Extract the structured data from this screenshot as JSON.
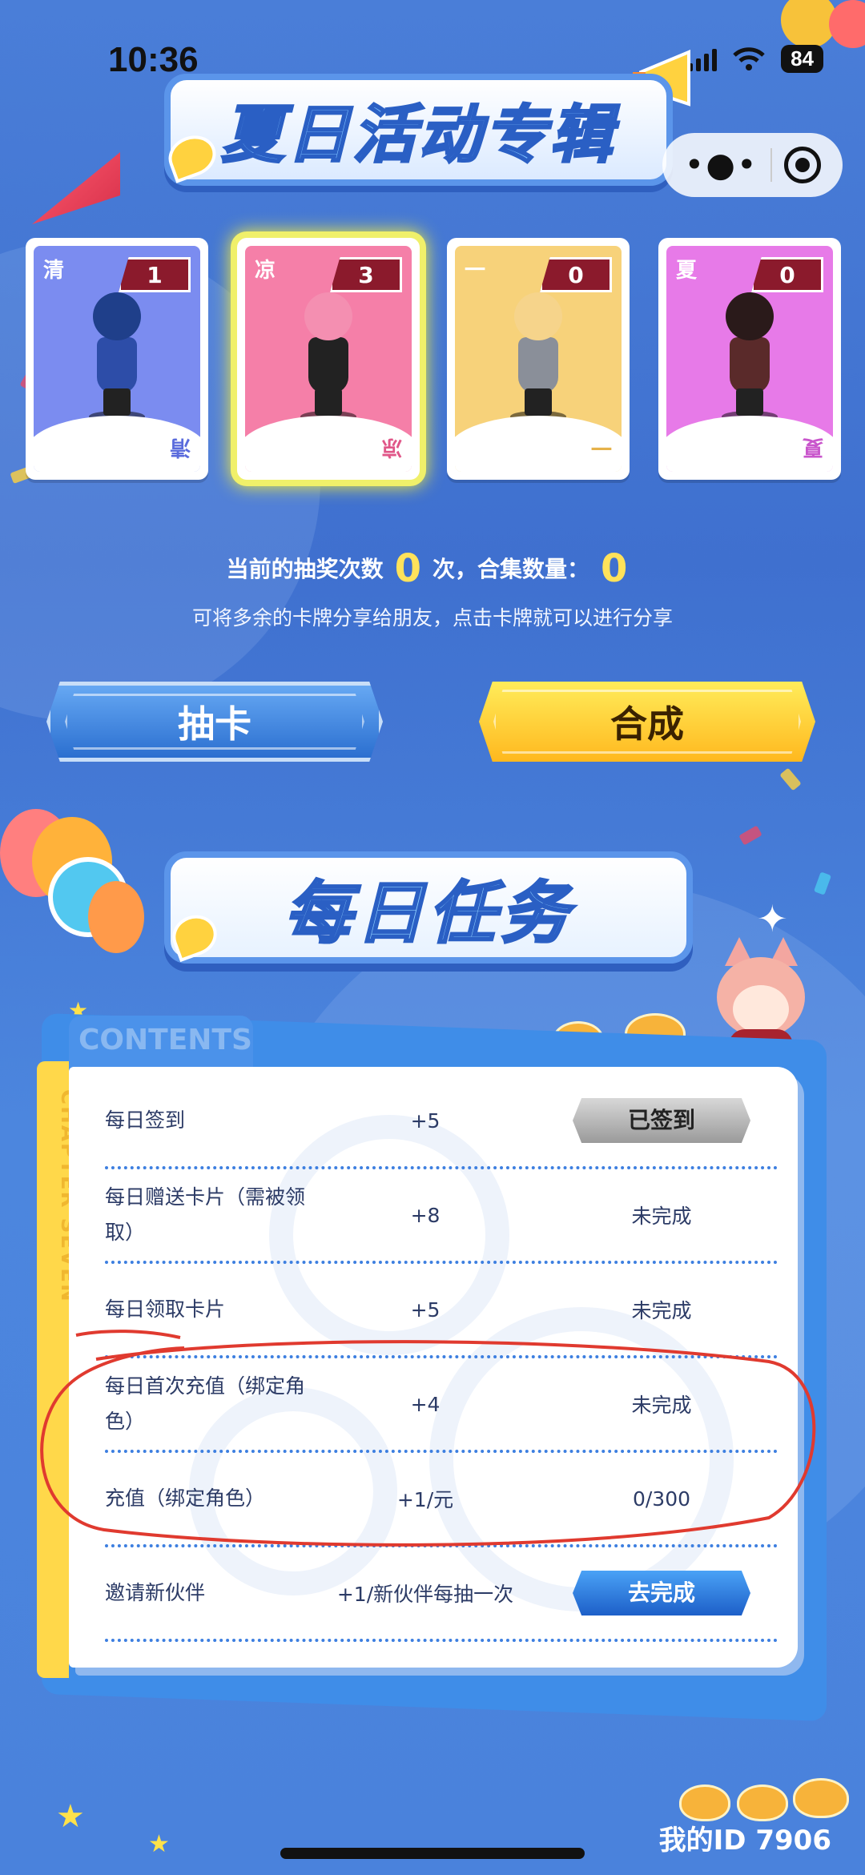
{
  "status_bar": {
    "time": "10:36",
    "battery": "84"
  },
  "header": {
    "title": "夏日活动专辑"
  },
  "cards": [
    {
      "char": "清",
      "count": "1",
      "bg": "#7b8cf0",
      "accent": "#5a6bdc",
      "hair": "#1f3f8a",
      "body": "#2d4da8"
    },
    {
      "char": "凉",
      "count": "3",
      "bg": "#f57fa8",
      "accent": "#e05688",
      "hair": "#f48fb1",
      "body": "#222222"
    },
    {
      "char": "一",
      "count": "0",
      "bg": "#f7d27a",
      "accent": "#e6b24a",
      "hair": "#f6d48b",
      "body": "#8a8f99"
    },
    {
      "char": "夏",
      "count": "0",
      "bg": "#e77ae8",
      "accent": "#c956cc",
      "hair": "#2a1a1a",
      "body": "#5a2a2a"
    }
  ],
  "info": {
    "draw_count_label": "当前的抽奖次数",
    "draw_count": "0",
    "draw_count_unit": "次，合集数量：",
    "collection_count": "0",
    "hint": "可将多余的卡牌分享给朋友，点击卡牌就可以进行分享"
  },
  "actions": {
    "draw_label": "抽卡",
    "merge_label": "合成"
  },
  "daily": {
    "title": "每日任务",
    "contents_tab": "CONTENTS",
    "chapter_label": "CHAPTER SEVEN"
  },
  "tasks": [
    {
      "name": "每日签到",
      "reward": "+5",
      "status": "已签到",
      "status_type": "done"
    },
    {
      "name": "每日赠送卡片（需被领取）",
      "reward": "+8",
      "status": "未完成",
      "status_type": "text"
    },
    {
      "name": "每日领取卡片",
      "reward": "+5",
      "status": "未完成",
      "status_type": "text"
    },
    {
      "name": "每日首次充值（绑定角色）",
      "reward": "+4",
      "status": "未完成",
      "status_type": "text"
    },
    {
      "name": "充值（绑定角色）",
      "reward": "+1/元",
      "status": "0/300",
      "status_type": "text"
    },
    {
      "name": "邀请新伙伴",
      "reward": "+1/新伙伴每抽一次",
      "status": "去完成",
      "status_type": "go"
    }
  ],
  "footer": {
    "my_id": "我的ID 7906"
  },
  "colors": {
    "background": "#4a7ed8",
    "annotation_red": "#e03a2f",
    "highlight_yellow": "#f5ee3a"
  },
  "icons": [
    "signal-icon",
    "wifi-icon",
    "battery-icon",
    "more-dots-icon",
    "target-close-icon",
    "megaphone-icon"
  ]
}
